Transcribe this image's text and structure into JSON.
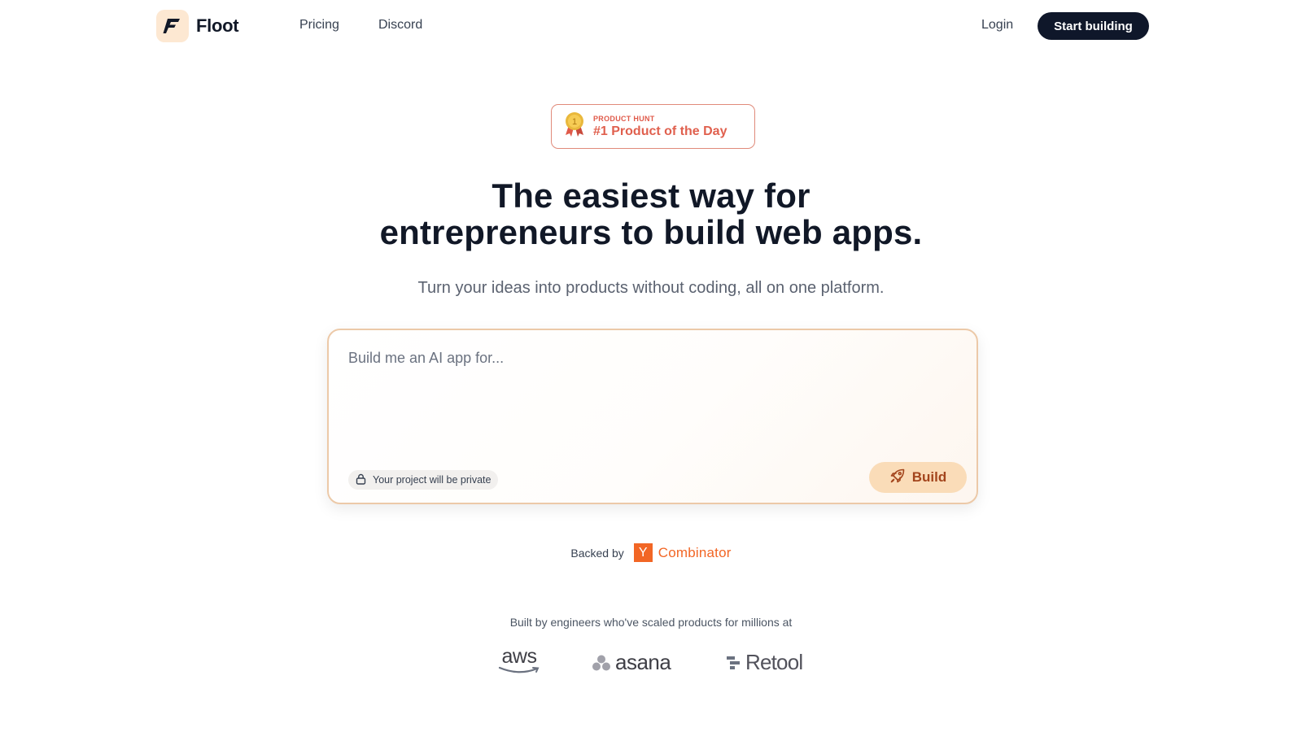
{
  "header": {
    "brand": "Floot",
    "nav": [
      "Pricing",
      "Discord"
    ],
    "login_label": "Login",
    "cta_label": "Start building"
  },
  "badge": {
    "small": "PRODUCT HUNT",
    "big": "#1 Product of the Day",
    "medal_number": "1"
  },
  "hero": {
    "title_line1": "The easiest way for",
    "title_line2": "entrepreneurs to build web apps.",
    "subtitle": "Turn your ideas into products without coding, all on one platform."
  },
  "prompt": {
    "placeholder": "Build me an AI app for...",
    "value": "",
    "private_label": "Your project will be private",
    "build_label": "Build"
  },
  "backed": {
    "label": "Backed by",
    "yc_letter": "Y",
    "yc_name": "Combinator"
  },
  "built_by": "Built by engineers who've scaled products for millions at",
  "logos": {
    "aws": "aws",
    "asana": "asana",
    "retool": "Retool"
  },
  "colors": {
    "accent": "#f26625",
    "cta_bg": "#0f172a",
    "build_bg": "#fadcb8",
    "badge": "#e0604e"
  }
}
